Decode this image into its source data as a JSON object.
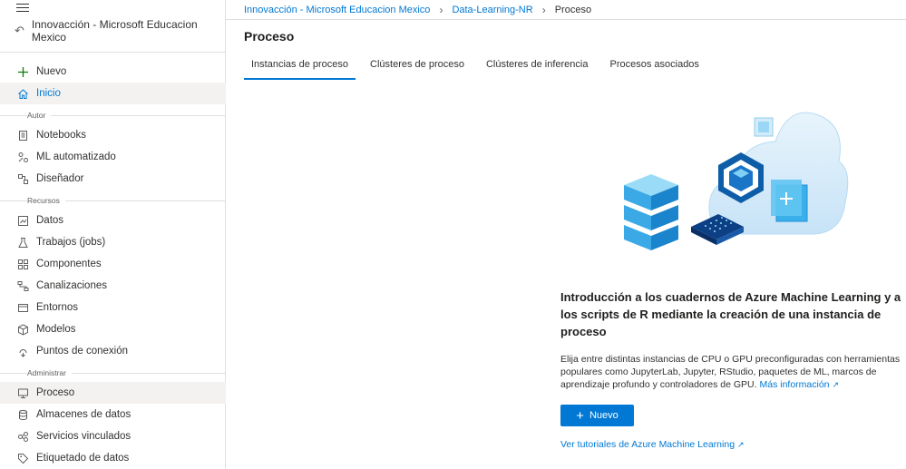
{
  "sidebar": {
    "workspace": "Innovacción - Microsoft Educacion Mexico",
    "new_label": "Nuevo",
    "home_label": "Inicio",
    "section_author": "Autor",
    "author_items": [
      "Notebooks",
      "ML automatizado",
      "Diseñador"
    ],
    "section_resources": "Recursos",
    "resource_items": [
      "Datos",
      "Trabajos (jobs)",
      "Componentes",
      "Canalizaciones",
      "Entornos",
      "Modelos",
      "Puntos de conexión"
    ],
    "section_manage": "Administrar",
    "manage_items": [
      "Proceso",
      "Almacenes de datos",
      "Servicios vinculados",
      "Etiquetado de datos"
    ]
  },
  "breadcrumb": {
    "items": [
      "Innovacción - Microsoft Educacion Mexico",
      "Data-Learning-NR"
    ],
    "current": "Proceso"
  },
  "page": {
    "title": "Proceso",
    "tabs": [
      "Instancias de proceso",
      "Clústeres de proceso",
      "Clústeres de inferencia",
      "Procesos asociados"
    ]
  },
  "empty_state": {
    "title": "Introducción a los cuadernos de Azure Machine Learning y a los scripts de R mediante la creación de una instancia de proceso",
    "description": "Elija entre distintas instancias de CPU o GPU preconfiguradas con herramientas populares como JupyterLab, Jupyter, RStudio, paquetes de ML, marcos de aprendizaje profundo y controladores de GPU.",
    "more_info": "Más información",
    "new_button": "Nuevo",
    "tutorials_link": "Ver tutoriales de Azure Machine Learning"
  }
}
